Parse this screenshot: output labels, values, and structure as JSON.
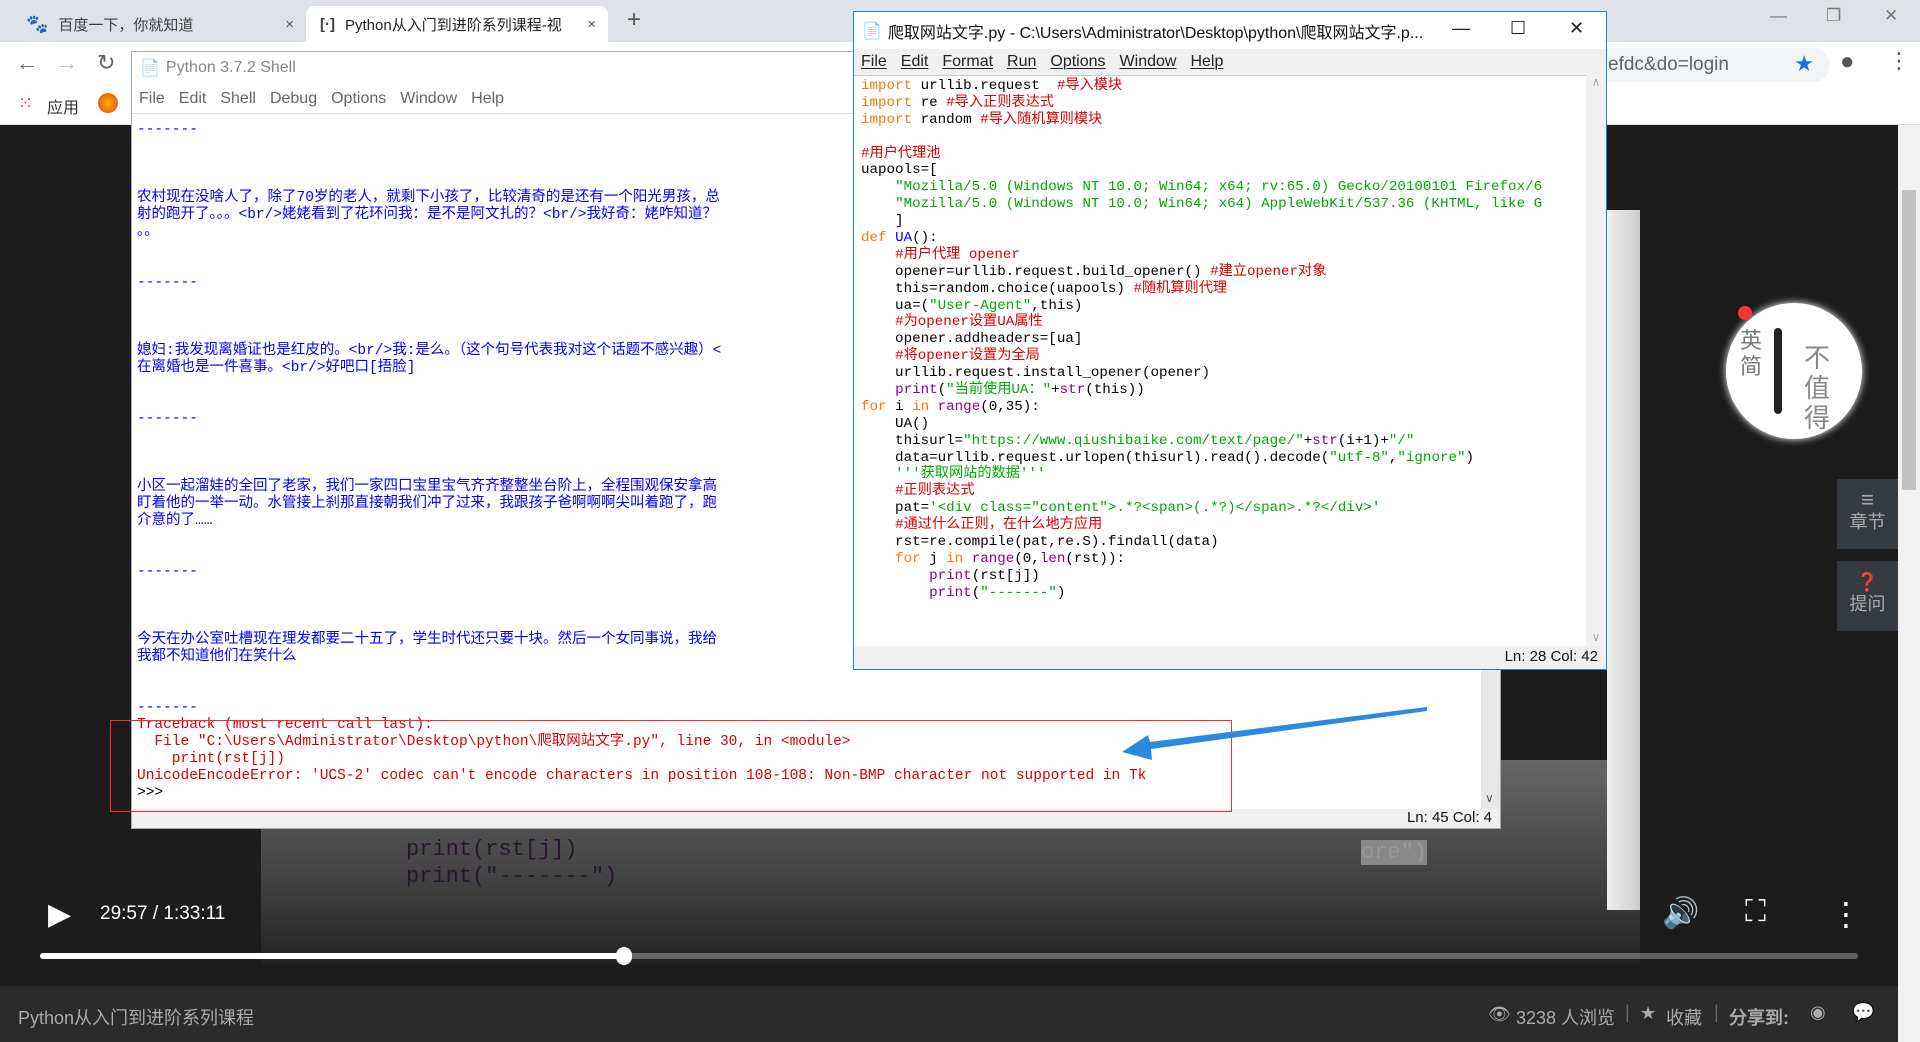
{
  "browser": {
    "tabs": [
      {
        "label": "百度一下，你就知道",
        "icon": "baidu-paw-icon",
        "active": false
      },
      {
        "label": "Python从入门到进阶系列课程-视",
        "icon": "site-icon",
        "active": true
      }
    ],
    "new_tab": "+",
    "close": "×",
    "address_fragment": "efdc&do=login",
    "bookmarks": [
      {
        "label": "应用",
        "icon": "apps-grid-icon"
      },
      {
        "label": "",
        "icon": "firefox-icon"
      }
    ]
  },
  "shell": {
    "title": "Python 3.7.2 Shell",
    "menu": [
      "File",
      "Edit",
      "Shell",
      "Debug",
      "Options",
      "Window",
      "Help"
    ],
    "lines": [
      {
        "t": "-------",
        "c": "out"
      },
      {
        "t": "",
        "c": "out"
      },
      {
        "t": "",
        "c": "out"
      },
      {
        "t": "",
        "c": "out"
      },
      {
        "t": "农村现在没啥人了，除了70岁的老人，就剩下小孩了，比较清奇的是还有一个阳光男孩，总",
        "c": "out"
      },
      {
        "t": "射的跑开了。。。<br/>姥姥看到了花环问我：是不是阿文扎的？<br/>我好奇：姥咋知道？",
        "c": "out"
      },
      {
        "t": "。。",
        "c": "out"
      },
      {
        "t": "",
        "c": "out"
      },
      {
        "t": "",
        "c": "out"
      },
      {
        "t": "-------",
        "c": "out"
      },
      {
        "t": "",
        "c": "out"
      },
      {
        "t": "",
        "c": "out"
      },
      {
        "t": "",
        "c": "out"
      },
      {
        "t": "媳妇:我发现离婚证也是红皮的。<br/>我:是么。（这个句号代表我对这个话题不感兴趣）<",
        "c": "out"
      },
      {
        "t": "在离婚也是一件喜事。<br/>好吧口[捂脸]",
        "c": "out"
      },
      {
        "t": "",
        "c": "out"
      },
      {
        "t": "",
        "c": "out"
      },
      {
        "t": "-------",
        "c": "out"
      },
      {
        "t": "",
        "c": "out"
      },
      {
        "t": "",
        "c": "out"
      },
      {
        "t": "",
        "c": "out"
      },
      {
        "t": "小区一起溜娃的全回了老家，我们一家四口宝里宝气齐齐整整坐台阶上，全程围观保安拿高",
        "c": "out"
      },
      {
        "t": "盯着他的一举一动。水管接上刹那直接朝我们冲了过来，我跟孩子爸啊啊啊尖叫着跑了，跑",
        "c": "out"
      },
      {
        "t": "介意的了……",
        "c": "out"
      },
      {
        "t": "",
        "c": "out"
      },
      {
        "t": "",
        "c": "out"
      },
      {
        "t": "-------",
        "c": "out"
      },
      {
        "t": "",
        "c": "out"
      },
      {
        "t": "",
        "c": "out"
      },
      {
        "t": "",
        "c": "out"
      },
      {
        "t": "今天在办公室吐槽现在理发都要二十五了，学生时代还只要十块。然后一个女同事说，我给",
        "c": "out"
      },
      {
        "t": "我都不知道他们在笑什么",
        "c": "out"
      },
      {
        "t": "",
        "c": "out"
      },
      {
        "t": "",
        "c": "out"
      },
      {
        "t": "-------",
        "c": "out"
      },
      {
        "t": "Traceback (most recent call last):",
        "c": "err"
      },
      {
        "t": "  File \"C:\\Users\\Administrator\\Desktop\\python\\爬取网站文字.py\", line 30, in <module>",
        "c": "err"
      },
      {
        "t": "    print(rst[j])",
        "c": "err"
      },
      {
        "t": "UnicodeEncodeError: 'UCS-2' codec can't encode characters in position 108-108: Non-BMP character not supported in Tk",
        "c": "err"
      },
      {
        "t": ">>> ",
        "c": "pl"
      }
    ],
    "status": "Ln: 45  Col: 4"
  },
  "editor": {
    "title": "爬取网站文字.py - C:\\Users\\Administrator\\Desktop\\python\\爬取网站文字.p...",
    "menu": [
      "File",
      "Edit",
      "Format",
      "Run",
      "Options",
      "Window",
      "Help"
    ],
    "status": "Ln: 28  Col: 42",
    "lines": [
      [
        [
          "kw",
          "import"
        ],
        [
          "pl",
          " urllib.request  "
        ],
        [
          "cm",
          "#导入模块"
        ]
      ],
      [
        [
          "kw",
          "import"
        ],
        [
          "pl",
          " re "
        ],
        [
          "cm",
          "#导入正则表达式"
        ]
      ],
      [
        [
          "kw",
          "import"
        ],
        [
          "pl",
          " random "
        ],
        [
          "cm",
          "#导入随机算则模块"
        ]
      ],
      [],
      [
        [
          "cm",
          "#用户代理池"
        ]
      ],
      [
        [
          "pl",
          "uapools=["
        ]
      ],
      [
        [
          "pl",
          "    "
        ],
        [
          "str",
          "\"Mozilla/5.0 (Windows NT 10.0; Win64; x64; rv:65.0) Gecko/20100101 Firefox/6"
        ]
      ],
      [
        [
          "pl",
          "    "
        ],
        [
          "str",
          "\"Mozilla/5.0 (Windows NT 10.0; Win64; x64) AppleWebKit/537.36 (KHTML, like G"
        ]
      ],
      [
        [
          "pl",
          "    ]"
        ]
      ],
      [
        [
          "kw",
          "def"
        ],
        [
          "pl",
          " "
        ],
        [
          "def",
          "UA"
        ],
        [
          "pl",
          "():"
        ]
      ],
      [
        [
          "pl",
          "    "
        ],
        [
          "cm",
          "#用户代理 opener"
        ]
      ],
      [
        [
          "pl",
          "    opener=urllib.request.build_opener() "
        ],
        [
          "cm",
          "#建立opener对象"
        ]
      ],
      [
        [
          "pl",
          "    this=random.choice(uapools) "
        ],
        [
          "cm",
          "#随机算则代理"
        ]
      ],
      [
        [
          "pl",
          "    ua=("
        ],
        [
          "str",
          "\"User-Agent\""
        ],
        [
          "pl",
          ",this)"
        ]
      ],
      [
        [
          "pl",
          "    "
        ],
        [
          "cm",
          "#为opener设置UA属性"
        ]
      ],
      [
        [
          "pl",
          "    opener.addheaders=[ua]"
        ]
      ],
      [
        [
          "pl",
          "    "
        ],
        [
          "cm",
          "#将opener设置为全局"
        ]
      ],
      [
        [
          "pl",
          "    urllib.request.install_opener(opener)"
        ]
      ],
      [
        [
          "pl",
          "    "
        ],
        [
          "bi",
          "print"
        ],
        [
          "pl",
          "("
        ],
        [
          "str",
          "\"当前使用UA：\""
        ],
        [
          "pl",
          "+"
        ],
        [
          "bi",
          "str"
        ],
        [
          "pl",
          "(this))"
        ]
      ],
      [
        [
          "kw",
          "for"
        ],
        [
          "pl",
          " i "
        ],
        [
          "kw",
          "in"
        ],
        [
          "pl",
          " "
        ],
        [
          "bi",
          "range"
        ],
        [
          "pl",
          "(0,35):"
        ]
      ],
      [
        [
          "pl",
          "    UA()"
        ]
      ],
      [
        [
          "pl",
          "    thisurl="
        ],
        [
          "str",
          "\"https://www.qiushibaike.com/text/page/\""
        ],
        [
          "pl",
          "+"
        ],
        [
          "bi",
          "str"
        ],
        [
          "pl",
          "(i+1)+"
        ],
        [
          "str",
          "\"/\""
        ]
      ],
      [
        [
          "pl",
          "    data=urllib.request.urlopen(thisurl).read().decode("
        ],
        [
          "str",
          "\"utf-8\""
        ],
        [
          "pl",
          ","
        ],
        [
          "str",
          "\"ignore\""
        ],
        [
          "pl",
          ")"
        ]
      ],
      [
        [
          "pl",
          "    "
        ],
        [
          "str",
          "'''获取网站的数据'''"
        ]
      ],
      [
        [
          "pl",
          "    "
        ],
        [
          "cm",
          "#正则表达式"
        ]
      ],
      [
        [
          "pl",
          "    pat="
        ],
        [
          "str",
          "'<div class=\"content\">.*?<span>(.*?)</span>.*?</div>'"
        ]
      ],
      [
        [
          "pl",
          "    "
        ],
        [
          "cm",
          "#通过什么正则，在什么地方应用"
        ]
      ],
      [
        [
          "pl",
          "    rst=re.compile(pat,re.S).findall(data)"
        ]
      ],
      [
        [
          "pl",
          "    "
        ],
        [
          "kw",
          "for"
        ],
        [
          "pl",
          " j "
        ],
        [
          "kw",
          "in"
        ],
        [
          "pl",
          " "
        ],
        [
          "bi",
          "range"
        ],
        [
          "pl",
          "(0,"
        ],
        [
          "bi",
          "len"
        ],
        [
          "pl",
          "(rst)):"
        ]
      ],
      [
        [
          "pl",
          "        "
        ],
        [
          "bi",
          "print"
        ],
        [
          "pl",
          "(rst[j])"
        ]
      ],
      [
        [
          "pl",
          "        "
        ],
        [
          "bi",
          "print"
        ],
        [
          "pl",
          "("
        ],
        [
          "str",
          "\"-------\""
        ],
        [
          "pl",
          ")"
        ]
      ]
    ]
  },
  "video": {
    "time": "29:57 / 1:33:11",
    "progress": 0.321,
    "background_code": [
      "print(rst[j])",
      "print(\"-------\")",
      "ore\")"
    ],
    "side_buttons": [
      {
        "label": "章节",
        "icon": "list-icon"
      },
      {
        "label": "提问",
        "icon": "question-icon"
      }
    ],
    "logo_text": "英简 不值得"
  },
  "footer": {
    "course_title": "Python从入门到进阶系列课程",
    "views": "3238 人浏览",
    "favorite": "收藏",
    "share": "分享到:"
  },
  "colors": {
    "annotation_red": "#ff2a2a",
    "arrow_blue": "#2a8ae0",
    "editor_border": "#1883d7"
  }
}
